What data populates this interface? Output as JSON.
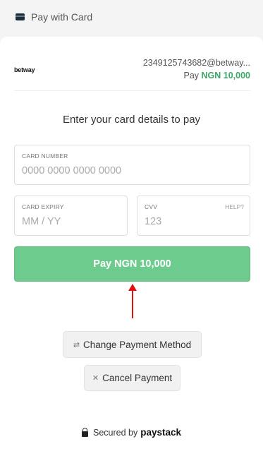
{
  "header": {
    "title": "Pay with Card",
    "icon": "card-icon"
  },
  "merchant": {
    "logo_text": "betway",
    "email": "2349125743682@betway...",
    "amount_prefix": "Pay",
    "amount": "NGN 10,000",
    "amount_color": "#39a767"
  },
  "form": {
    "heading": "Enter your card details to pay",
    "card_number": {
      "label": "CARD NUMBER",
      "placeholder": "0000 0000 0000 0000"
    },
    "card_expiry": {
      "label": "CARD EXPIRY",
      "placeholder": "MM / YY"
    },
    "cvv": {
      "label": "CVV",
      "placeholder": "123",
      "help": "HELP?"
    },
    "pay_button": "Pay NGN 10,000",
    "pay_button_color": "#6ecb8e"
  },
  "actions": {
    "change_method": {
      "label": "Change Payment Method",
      "icon": "swap-icon"
    },
    "cancel": {
      "label": "Cancel Payment",
      "icon": "close-icon"
    }
  },
  "footer": {
    "secured_text": "Secured by",
    "brand": "paystack",
    "icon": "lock-icon"
  },
  "annotation": {
    "arrow_color": "#e0100f",
    "icon": "red-arrow-up-icon"
  }
}
